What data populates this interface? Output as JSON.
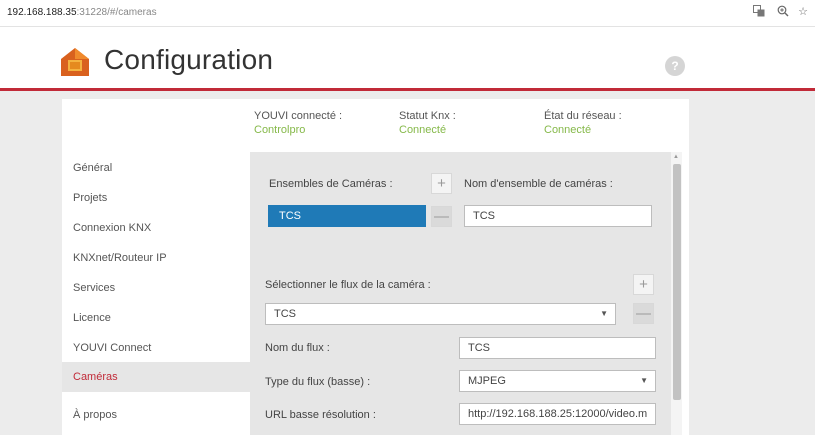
{
  "browser": {
    "url_host": "192.168.188.35",
    "url_rest": ":31228/#/cameras",
    "icons": [
      "translate-icon",
      "zoom-icon",
      "star-icon"
    ]
  },
  "header": {
    "title": "Configuration",
    "help": "?",
    "accent_color": "#c12a38"
  },
  "status": [
    {
      "label": "YOUVI connecté :",
      "value": "Controlpro"
    },
    {
      "label": "Statut Knx :",
      "value": "Connecté"
    },
    {
      "label": "État du réseau :",
      "value": "Connecté"
    }
  ],
  "status_value_color": "#86b94a",
  "sidebar": {
    "items": [
      {
        "label": "Général"
      },
      {
        "label": "Projets"
      },
      {
        "label": "Connexion KNX"
      },
      {
        "label": "KNXnet/Routeur IP"
      },
      {
        "label": "Services"
      },
      {
        "label": "Licence"
      },
      {
        "label": "YOUVI Connect"
      },
      {
        "label": "Caméras",
        "active": true
      },
      {
        "label": "À propos"
      }
    ]
  },
  "cameras": {
    "sets_label": "Ensembles de Caméras :",
    "set_name_label": "Nom d'ensemble de caméras :",
    "sets": [
      "TCS"
    ],
    "set_name_value": "TCS",
    "add_symbol": "+",
    "remove_symbol": "—",
    "stream_select_label": "Sélectionner le flux de la caméra :",
    "stream_selected": "TCS",
    "stream_name_label": "Nom du flux :",
    "stream_name_value": "TCS",
    "stream_type_label": "Type du flux (basse) :",
    "stream_type_value": "MJPEG",
    "low_res_url_label": "URL basse résolution :",
    "low_res_url_value": "http://192.168.188.25:12000/video.m"
  }
}
